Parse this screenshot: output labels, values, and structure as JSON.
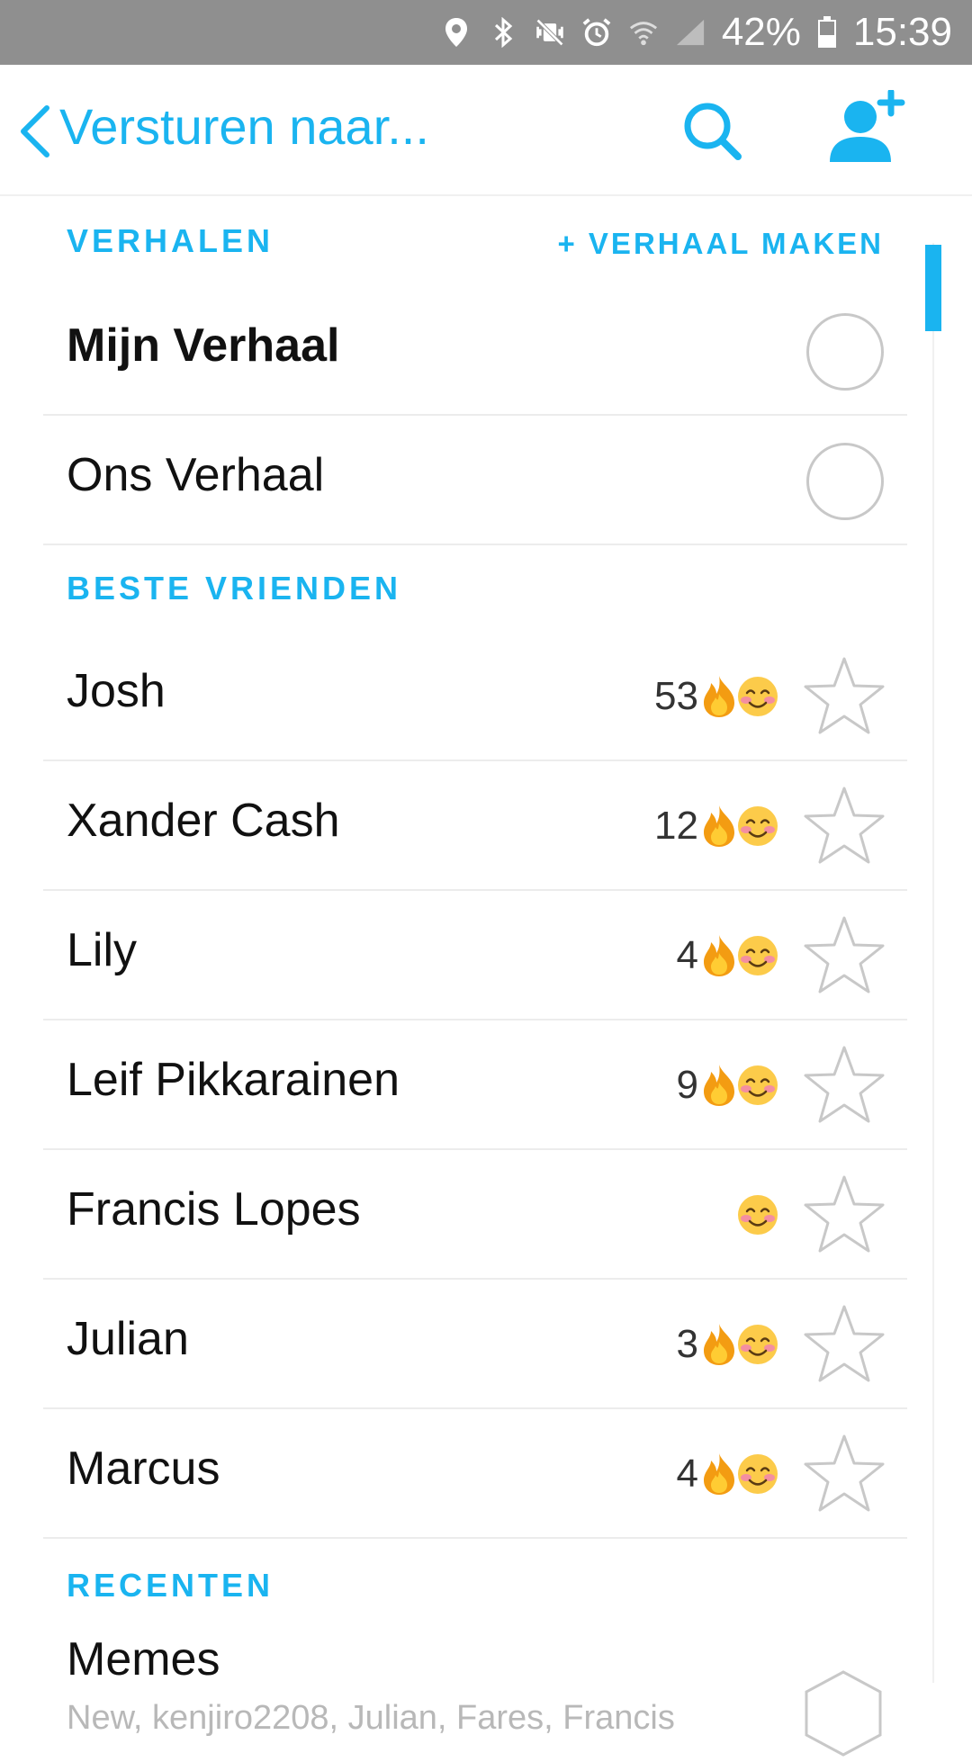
{
  "status_bar": {
    "battery": "42%",
    "time": "15:39",
    "icons": [
      "location-icon",
      "bluetooth-icon",
      "vibrate-mute-icon",
      "alarm-icon",
      "wifi-icon",
      "signal-icon",
      "battery-icon"
    ]
  },
  "header": {
    "title": "Versturen naar...",
    "accent_color": "#1ab4f0"
  },
  "stories": {
    "section_title": "VERHALEN",
    "make_story_label": "VERHAAL MAKEN",
    "items": [
      {
        "name": "Mijn Verhaal"
      },
      {
        "name": "Ons Verhaal"
      }
    ]
  },
  "best_friends": {
    "section_title": "BESTE VRIENDEN",
    "items": [
      {
        "name": "Josh",
        "streak": "53"
      },
      {
        "name": "Xander Cash",
        "streak": "12"
      },
      {
        "name": "Lily",
        "streak": "4"
      },
      {
        "name": "Leif Pikkarainen",
        "streak": "9"
      },
      {
        "name": "Francis Lopes",
        "streak": ""
      },
      {
        "name": "Julian",
        "streak": "3"
      },
      {
        "name": "Marcus",
        "streak": "4"
      }
    ]
  },
  "recents": {
    "section_title": "RECENTEN",
    "items": [
      {
        "name": "Memes",
        "members": "New, kenjiro2208, Julian, Fares, Francis"
      }
    ]
  }
}
